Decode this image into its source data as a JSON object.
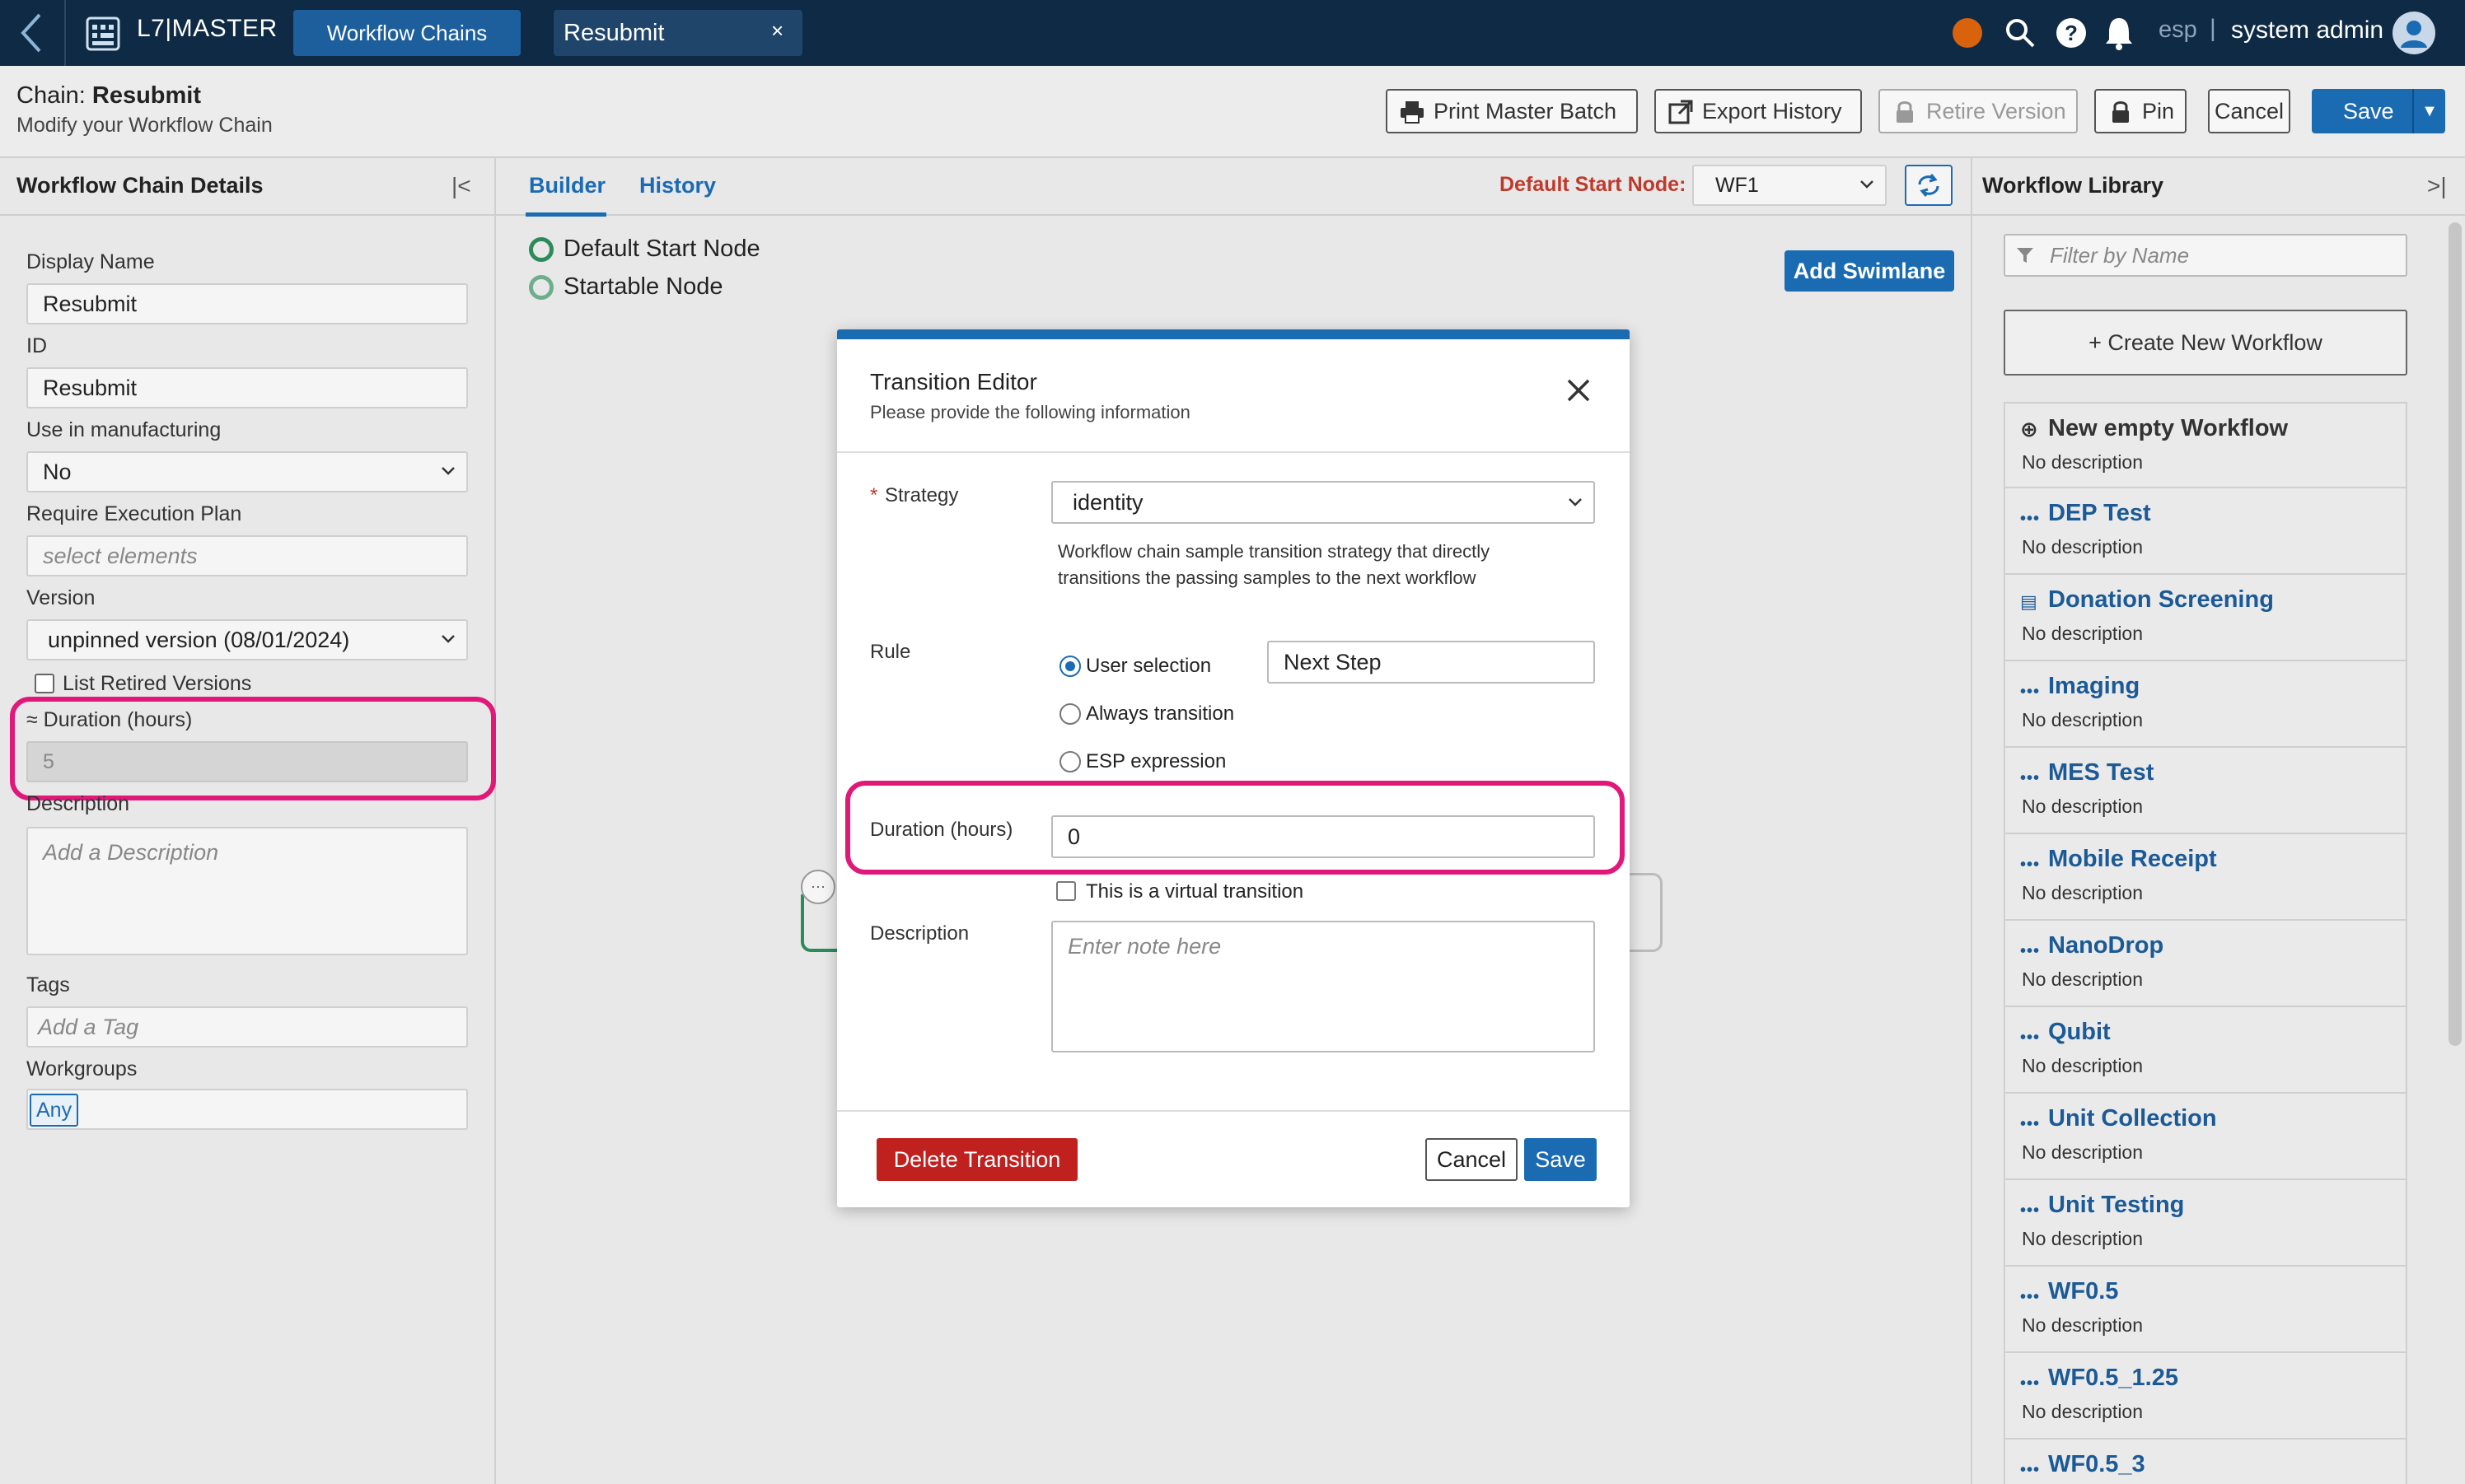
{
  "topbar": {
    "app_name": "L7|MASTER",
    "tabs": [
      {
        "label": "Workflow Chains"
      },
      {
        "label": "Resubmit"
      }
    ],
    "tab_close": "×",
    "lang": "esp",
    "lang_separator": "|",
    "user": "system admin",
    "status_color": "#d9620c"
  },
  "header": {
    "title_prefix": "Chain: ",
    "title_name": "Resubmit",
    "subtitle": "Modify your Workflow Chain",
    "buttons": {
      "print": "Print Master Batch",
      "export": "Export History",
      "retire": "Retire Version",
      "pin": "Pin",
      "cancel": "Cancel",
      "save": "Save"
    }
  },
  "left": {
    "title": "Workflow Chain Details",
    "collapse_icon": "collapse-left-icon",
    "display_name_label": "Display Name",
    "display_name": "Resubmit",
    "id_label": "ID",
    "id": "Resubmit",
    "manufacturing_label": "Use in manufacturing",
    "manufacturing": "No",
    "exec_plan_label": "Require Execution Plan",
    "exec_plan_placeholder": "select elements",
    "version_label": "Version",
    "version": "unpinned version (08/01/2024)",
    "retired_label": "List Retired Versions",
    "duration_label": "≈ Duration (hours)",
    "duration": "5",
    "description_label": "Description",
    "description_placeholder": "Add a Description",
    "tags_label": "Tags",
    "tags_placeholder": "Add a Tag",
    "workgroups_label": "Workgroups",
    "workgroup": "Any"
  },
  "center": {
    "tabs": [
      "Builder",
      "History"
    ],
    "default_start_label": "Default Start Node:",
    "default_start_value": "WF1",
    "legend": [
      "Default Start Node",
      "Startable Node"
    ],
    "add_swimlane": "Add Swimlane",
    "node_menu": "···"
  },
  "modal": {
    "title": "Transition Editor",
    "subtitle": "Please provide the following information",
    "strategy_label": "Strategy",
    "strategy_required": "*",
    "strategy": "identity",
    "strategy_help": "Workflow chain sample transition strategy that directly transitions the passing samples to the next workflow",
    "rule_label": "Rule",
    "rule_options": [
      "User selection",
      "Always transition",
      "ESP expression"
    ],
    "rule_selected": "User selection",
    "rule_value": "Next Step",
    "duration_label": "Duration (hours)",
    "duration": "0",
    "virtual_label": "This is a virtual transition",
    "description_label": "Description",
    "description_placeholder": "Enter note here",
    "delete": "Delete Transition",
    "cancel": "Cancel",
    "save": "Save"
  },
  "library": {
    "title": "Workflow Library",
    "filter_placeholder": "Filter by Name",
    "create_new": "+ Create New Workflow",
    "items": [
      {
        "name": "New empty Workflow",
        "desc": "No description",
        "icon": "plus-circle-icon"
      },
      {
        "name": "DEP Test",
        "desc": "No description",
        "icon": "dots-icon"
      },
      {
        "name": "Donation Screening",
        "desc": "No description",
        "icon": "document-icon"
      },
      {
        "name": "Imaging",
        "desc": "No description",
        "icon": "dots-icon"
      },
      {
        "name": "MES Test",
        "desc": "No description",
        "icon": "dots-icon"
      },
      {
        "name": "Mobile Receipt",
        "desc": "No description",
        "icon": "dots-icon"
      },
      {
        "name": "NanoDrop",
        "desc": "No description",
        "icon": "dots-icon"
      },
      {
        "name": "Qubit",
        "desc": "No description",
        "icon": "dots-icon"
      },
      {
        "name": "Unit Collection",
        "desc": "No description",
        "icon": "dots-icon"
      },
      {
        "name": "Unit Testing",
        "desc": "No description",
        "icon": "dots-icon"
      },
      {
        "name": "WF0.5",
        "desc": "No description",
        "icon": "dots-icon"
      },
      {
        "name": "WF0.5_1.25",
        "desc": "No description",
        "icon": "dots-icon"
      },
      {
        "name": "WF0.5_3",
        "desc": "",
        "icon": "dots-icon"
      }
    ]
  },
  "colors": {
    "topbar": "#0f2a44",
    "accent": "#1b6bb3",
    "danger": "#c0201e",
    "highlight": "#e0187a",
    "start_node": "#2d8a5b"
  }
}
